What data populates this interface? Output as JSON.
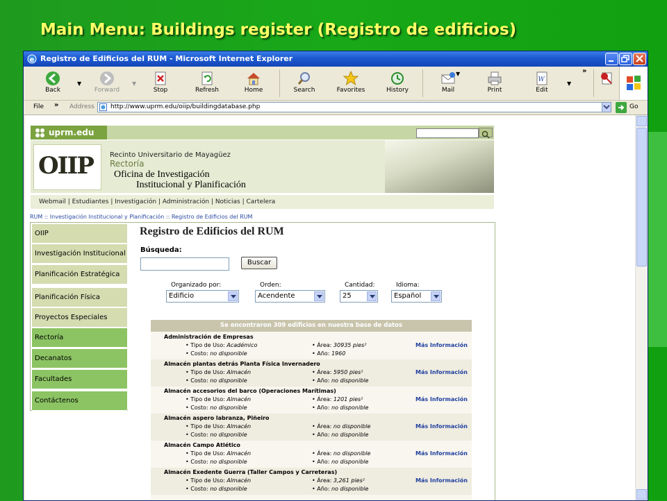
{
  "slide": {
    "title": "Main Menu: Buildings register (Registro de edificios)"
  },
  "window": {
    "title": "Registro de Edificios del RUM - Microsoft Internet Explorer"
  },
  "toolbar": {
    "back": "Back",
    "forward": "Forward",
    "stop": "Stop",
    "refresh": "Refresh",
    "home": "Home",
    "search": "Search",
    "favorites": "Favorites",
    "history": "History",
    "mail": "Mail",
    "print": "Print",
    "edit": "Edit"
  },
  "menu": {
    "file": "File"
  },
  "address": {
    "label": "Address",
    "url": "http://www.uprm.edu/oiip/buildingdatabase.php",
    "go": "Go"
  },
  "site": {
    "logo": "uprm.edu",
    "banner": {
      "oiip": "OIIP",
      "line1": "Recinto Universitario de Mayagüez",
      "line2": "Rectoría",
      "line3": "Oficina de Investigación",
      "line4": "Institucional y Planificación"
    },
    "nav": "Webmail | Estudiantes | Investigación | Administración | Noticias | Cartelera",
    "breadcrumb": "RUM :: Investigación Institucional y Planificación :: Registro de Edificios del RUM"
  },
  "sidebar": {
    "items": [
      {
        "label": "OIIP"
      },
      {
        "label": "Investigación Institucional"
      },
      {
        "label": "Planificación Estratégica"
      },
      {
        "label": "Planificación Física"
      },
      {
        "label": "Proyectos Especiales"
      },
      {
        "label": "Rectoría"
      },
      {
        "label": "Decanatos"
      },
      {
        "label": "Facultades"
      },
      {
        "label": "Contáctenos"
      }
    ]
  },
  "content": {
    "title": "Registro de Edificios del RUM",
    "search_label": "Búsqueda:",
    "search_value": "",
    "search_button": "Buscar",
    "filters": {
      "organizado_label": "Organizado por:",
      "organizado_value": "Edificio",
      "orden_label": "Orden:",
      "orden_value": "Acendente",
      "cantidad_label": "Cantidad:",
      "cantidad_value": "25",
      "idioma_label": "Idioma:",
      "idioma_value": "Español"
    },
    "results_header": "Se encontraron 309 edificios en nuestra base de datos",
    "records": [
      {
        "name": "Administración de Empresas",
        "uso": "Académico",
        "area": "30935 pies²",
        "costo": "no disponible",
        "ano": "1960",
        "more": "Más Información"
      },
      {
        "name": "Almacén plantas detrás Planta Física Invernadero",
        "uso": "Almacén",
        "area": "5950 pies²",
        "costo": "no disponible",
        "ano": "no disponible",
        "more": "Más Información"
      },
      {
        "name": "Almacén accesorios del barco (Operaciones Marítimas)",
        "uso": "Almacén",
        "area": "1201 pies²",
        "costo": "no disponible",
        "ano": "no disponible",
        "more": "Más Información"
      },
      {
        "name": "Almacén aspero labranza, Piñeiro",
        "uso": "Almacén",
        "area": "no disponible",
        "costo": "no disponible",
        "ano": "no disponible",
        "more": "Más Información"
      },
      {
        "name": "Almacén Campo Atlético",
        "uso": "Almacén",
        "area": "no disponible",
        "costo": "no disponible",
        "ano": "no disponible",
        "more": "Más Información"
      },
      {
        "name": "Almacén Exedente Guerra (Taller Campos y Carreteras)",
        "uso": "Almacén",
        "area": "3,261 pies²",
        "costo": "no disponible",
        "ano": "no disponible",
        "more": "Más Información"
      }
    ],
    "field_labels": {
      "uso": "• Tipo de Uso:",
      "area": "• Área:",
      "costo": "• Costo:",
      "ano": "• Año:"
    }
  },
  "colors": {
    "slide_bg": "#18a818",
    "title_yellow": "#ffff66",
    "xp_blue": "#1c59d0",
    "sidebar_green": "#8cc463",
    "sidebar_tan": "#d4dcb0"
  }
}
